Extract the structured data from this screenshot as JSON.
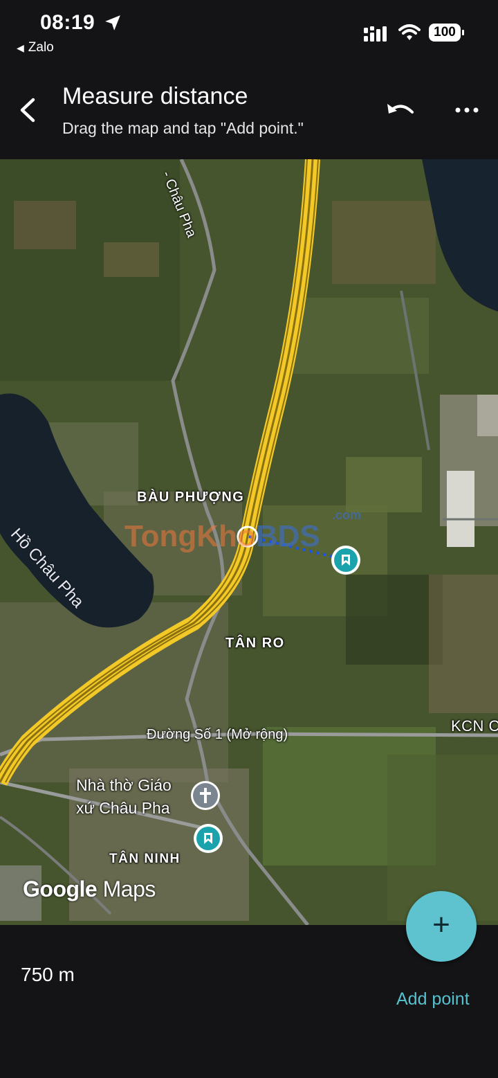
{
  "status_bar": {
    "time": "08:19",
    "back_app": "Zalo",
    "battery": "100",
    "icons": [
      "location-arrow-icon",
      "signal-icon",
      "wifi-icon",
      "battery-icon"
    ]
  },
  "header": {
    "title": "Measure distance",
    "subtitle": "Drag the map and tap \"Add point.\"",
    "icons": [
      "back-arrow-icon",
      "undo-icon",
      "more-icon"
    ]
  },
  "map": {
    "labels": {
      "chau_pha_road": "- Châu Pha",
      "bau_phuong": "BÀU PHƯỢNG",
      "tan_ro": "TÂN RO",
      "tan_ninh": "TÂN NINH",
      "kcn": "KCN C",
      "duong_so_1": "Đường Số 1 (Mở rộng)",
      "lake": "Hồ Châu Pha",
      "church_line1": "Nhà thờ Giáo",
      "church_line2": "xứ Châu Pha"
    },
    "watermark": {
      "main": "TongKho",
      "bds": "BDS",
      "com": ".com"
    },
    "google_logo": "Google",
    "maps_logo": "Maps",
    "colors": {
      "highway": "#f3c928",
      "measure_line": "#1a55e8",
      "pin": "#1ba3ad"
    }
  },
  "bottom": {
    "distance": "750 m",
    "add_point_label": "Add point",
    "fab_symbol": "+"
  }
}
